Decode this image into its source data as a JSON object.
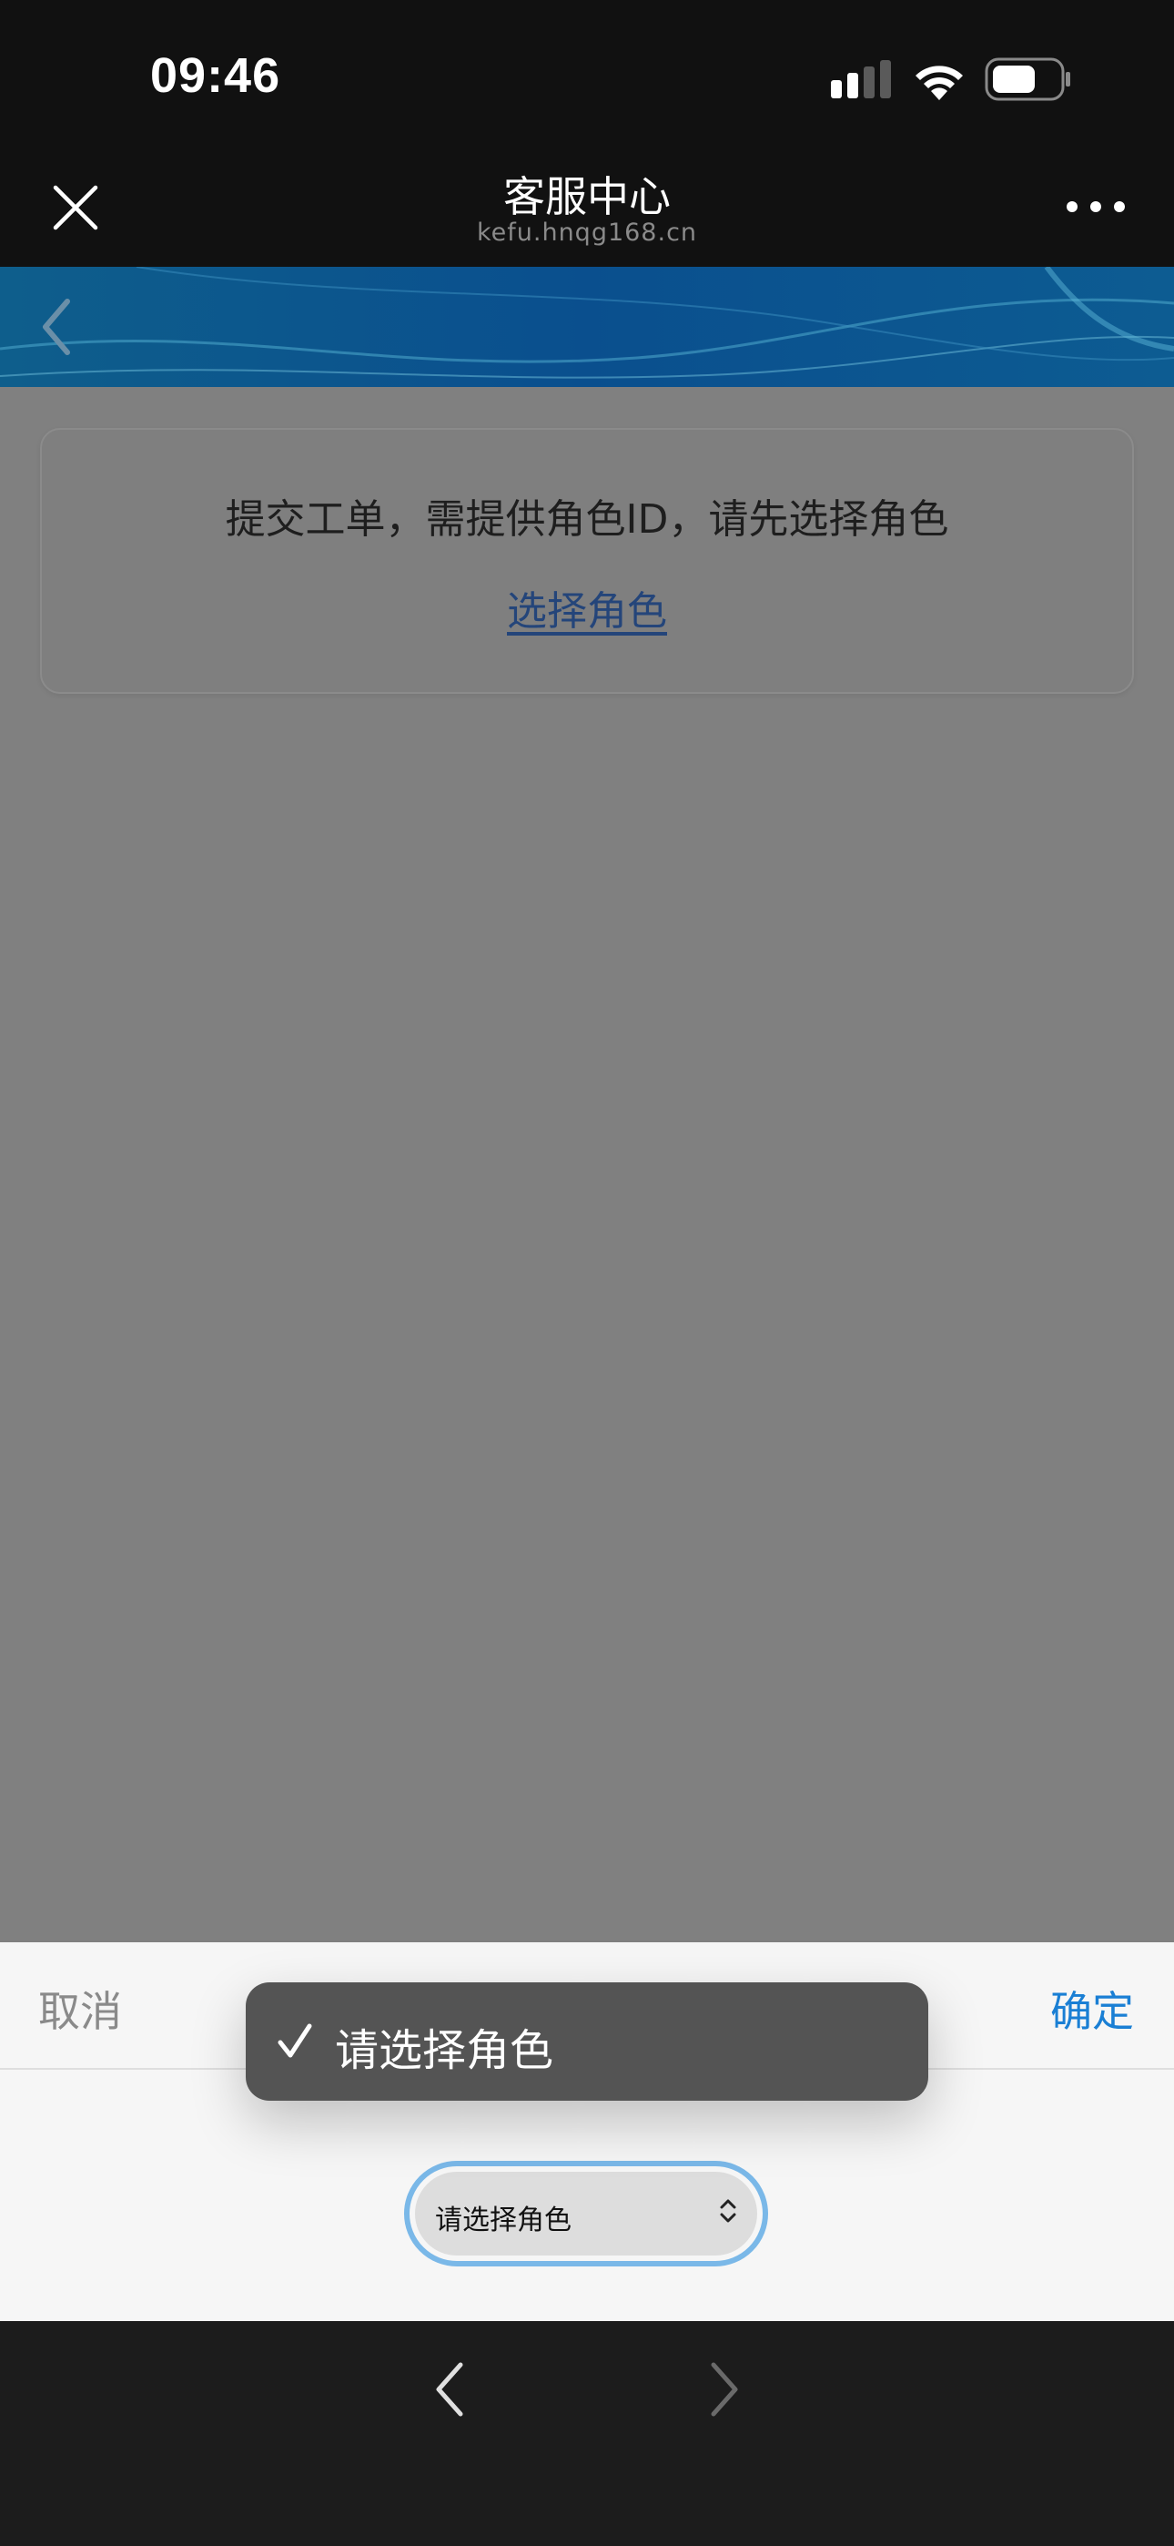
{
  "status_bar": {
    "time": "09:46",
    "icons": [
      "signal-icon",
      "wifi-icon",
      "battery-icon"
    ]
  },
  "nav_bar": {
    "title": "客服中心",
    "url": "kefu.hnqg168.cn",
    "close_icon": "close-icon",
    "more_icon": "more-icon"
  },
  "header": {
    "back_icon": "back-arrow-icon"
  },
  "card": {
    "message": "提交工单，需提供角色ID，请先选择角色",
    "link": "选择角色"
  },
  "picker": {
    "cancel_label": "取消",
    "confirm_label": "确定",
    "select_value": "请选择角色"
  },
  "popup": {
    "selected_option": "请选择角色"
  },
  "colors": {
    "accent": "#1a7fd4",
    "link": "#24457a",
    "overlay": "#808080"
  }
}
